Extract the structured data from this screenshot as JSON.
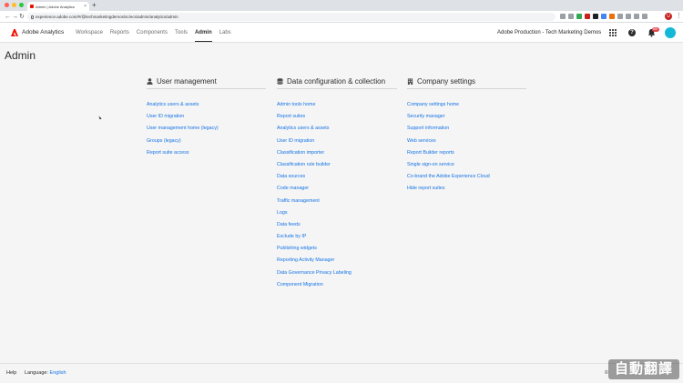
{
  "browser": {
    "tab_title": "Admin | Adobe Analytics",
    "tab_close": "×",
    "new_tab": "+",
    "url": "experience.adobe.com/#/@techmarketingdemos/sc/ecs/admin/analytics/admin",
    "nav": {
      "back": "←",
      "forward": "→",
      "reload": "↻"
    },
    "profile_initial": "U",
    "menu": "⋮",
    "traffic_colors": [
      "#ff5f57",
      "#febc2e",
      "#28c840"
    ],
    "ext_colors": [
      "#9aa0a6",
      "#9aa0a6",
      "#34a853",
      "#c5221f",
      "#202124",
      "#4285f4",
      "#e8710a",
      "#9aa0a6",
      "#9aa0a6",
      "#9aa0a6",
      "#9aa0a6"
    ]
  },
  "header": {
    "brand": "Adobe Analytics",
    "menu": [
      {
        "label": "Workspace",
        "active": false
      },
      {
        "label": "Reports",
        "active": false
      },
      {
        "label": "Components",
        "active": false
      },
      {
        "label": "Tools",
        "active": false
      },
      {
        "label": "Admin",
        "active": true
      },
      {
        "label": "Labs",
        "active": false
      }
    ],
    "org": "Adobe Production - Tech Marketing Demos",
    "help_glyph": "?",
    "notification_count": "99+",
    "accent": "#eb1000"
  },
  "page": {
    "title": "Admin"
  },
  "sections": [
    {
      "title": "User management",
      "icon": "user-icon",
      "links": [
        "Analytics users & assets",
        "User ID migration",
        "User management home (legacy)",
        "Groups (legacy)",
        "Report suite access"
      ]
    },
    {
      "title": "Data configuration & collection",
      "icon": "database-icon",
      "links": [
        "Admin tools home",
        "Report suites",
        "Analytics users & assets",
        "User ID migration",
        "Classification importer",
        "Classification rule builder",
        "Data sources",
        "Code manager",
        "Traffic management",
        "Logs",
        "Data feeds",
        "Exclude by IP",
        "Publishing widgets",
        "Reporting Activity Manager",
        "Data Governance Privacy Labeling",
        "Component Migration"
      ]
    },
    {
      "title": "Company settings",
      "icon": "building-icon",
      "links": [
        "Company settings home",
        "Security manager",
        "Support information",
        "Web services",
        "Report Builder reports",
        "Single sign-on service",
        "Co-brand the Adobe Experience Cloud",
        "Hide report suites"
      ]
    }
  ],
  "footer": {
    "help": "Help",
    "language_label": "Language:",
    "language_value": "English",
    "copyright": "©"
  },
  "watermark": "自動翻譯"
}
